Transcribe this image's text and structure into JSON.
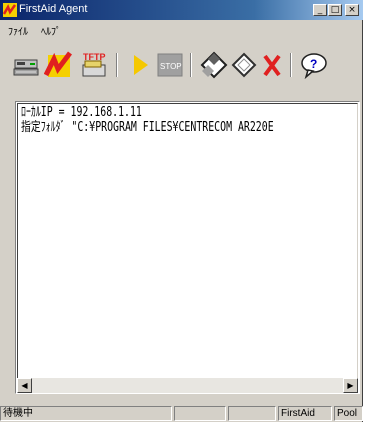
{
  "window": {
    "title": "FirstAid Agent",
    "controls": {
      "minimize": "_",
      "maximize": "□",
      "close": "×"
    }
  },
  "menu": [
    {
      "label": "ﾌｧｲﾙ"
    },
    {
      "label": "ﾍﾙﾌﾟ"
    }
  ],
  "toolbar": {
    "buttons": [
      {
        "icon": "network-computer-icon"
      },
      {
        "icon": "firstaid-lightning-icon"
      },
      {
        "icon": "tftp-icon",
        "text": "TFTP"
      },
      {
        "icon": "play-icon"
      },
      {
        "icon": "stop-icon",
        "text": "STOP"
      },
      {
        "icon": "diamond-tiles-icon"
      },
      {
        "icon": "clear-diamond-icon"
      },
      {
        "icon": "red-x-icon"
      },
      {
        "icon": "help-balloon-icon",
        "text": "?"
      }
    ]
  },
  "log": {
    "lines": [
      "ﾛｰｶﾙIP = 192.168.1.11",
      "指定ﾌｫﾙﾀﾞ \"C:¥PROGRAM FILES¥CENTRECOM AR220E"
    ]
  },
  "scrollbar": {
    "left": "◀",
    "right": "▶"
  },
  "status": {
    "state": "待機中",
    "app": "FirstAid",
    "mode": "Pool"
  },
  "colors": {
    "title_start": "#0a246a",
    "title_end": "#a6caf0",
    "face": "#d4d0c8",
    "accent_red": "#e02020",
    "accent_yellow": "#f5d000"
  }
}
